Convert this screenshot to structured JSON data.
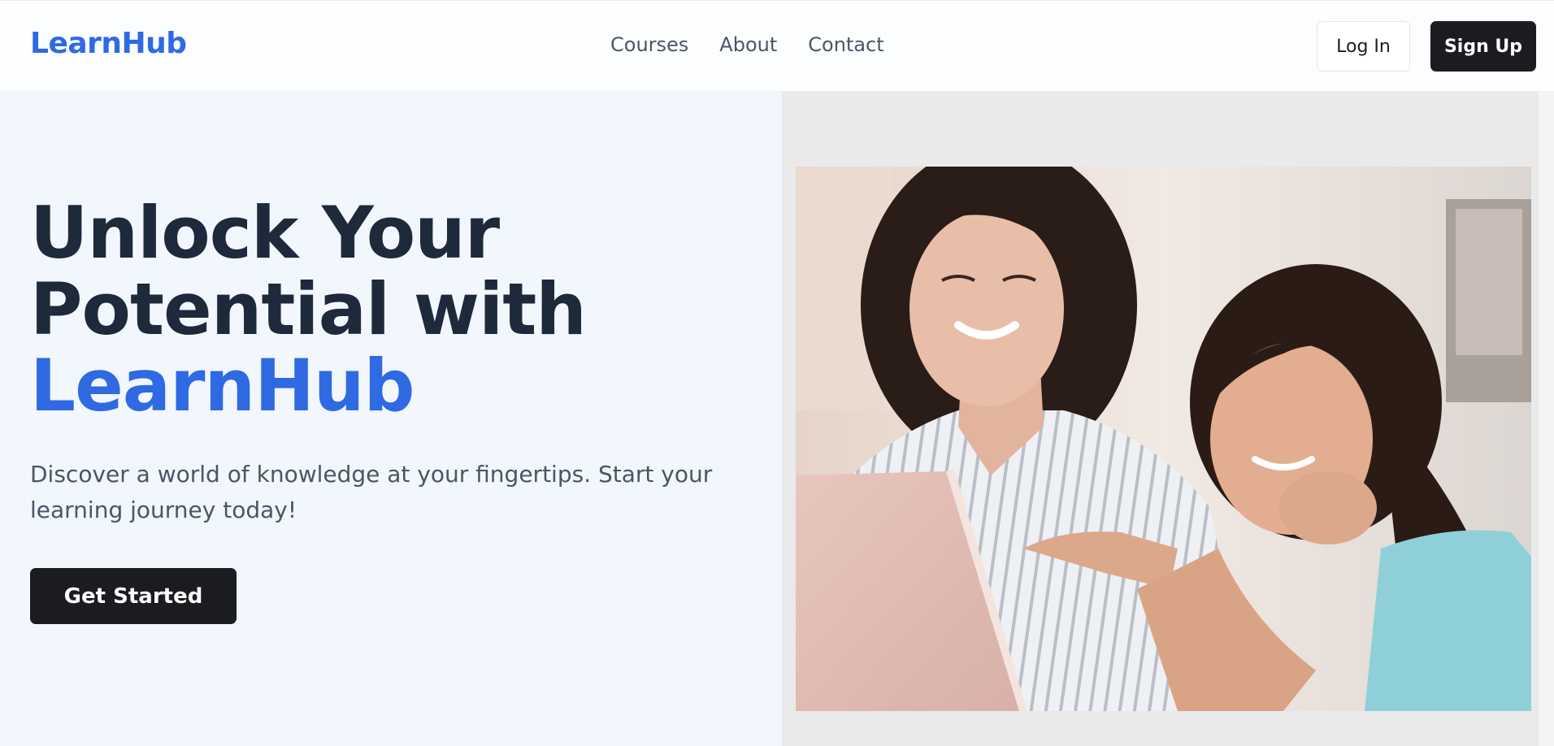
{
  "brand": {
    "name": "LearnHub",
    "color": "#2f6ae3"
  },
  "nav": {
    "links": [
      "Courses",
      "About",
      "Contact"
    ]
  },
  "auth": {
    "login_label": "Log In",
    "signup_label": "Sign Up"
  },
  "hero": {
    "headline_line1": "Unlock Your",
    "headline_line2": "Potential with",
    "headline_accent": "LearnHub",
    "subtitle": "Discover a world of knowledge at your fingertips. Start your learning journey today!",
    "cta_label": "Get Started",
    "image_icon": "photo-of-woman-and-girl-using-laptop"
  },
  "colors": {
    "accent": "#2f6ae3",
    "dark": "#1b1c1f",
    "heading": "#1e293b",
    "body_text": "#4c5566",
    "hero_bg": "#f2f7fe",
    "image_panel_bg": "#eaeaea"
  }
}
